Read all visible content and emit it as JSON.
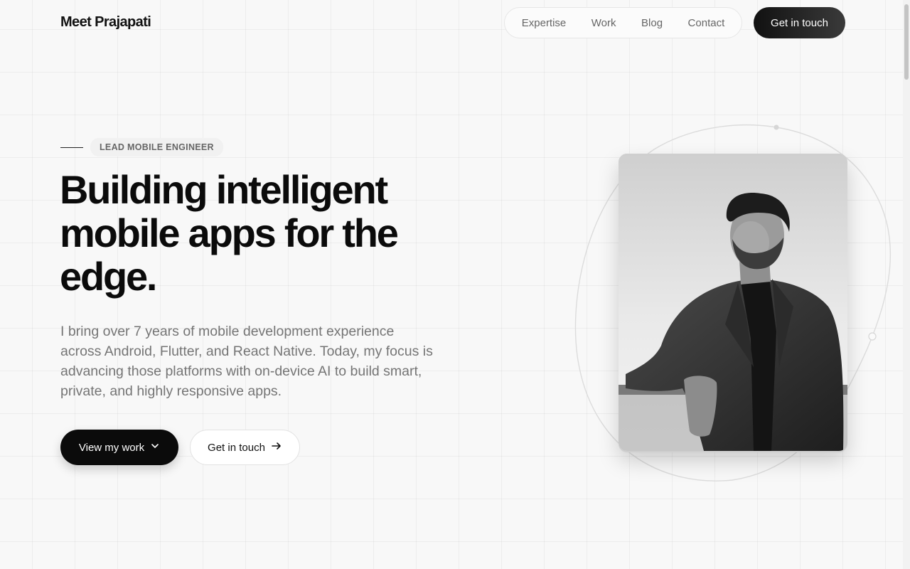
{
  "header": {
    "brand": "Meet Prajapati",
    "nav": [
      "Expertise",
      "Work",
      "Blog",
      "Contact"
    ],
    "cta_label": "Get in touch"
  },
  "hero": {
    "eyebrow": "LEAD MOBILE ENGINEER",
    "headline_lines": [
      "Building intelligent",
      "mobile apps for the",
      "edge."
    ],
    "lead": "I bring over 7 years of mobile development experience across Android, Flutter, and React Native. Today, my focus is advancing those platforms with on-device AI to build smart, private, and highly responsive apps.",
    "primary_button": "View my work",
    "secondary_button": "Get in touch"
  },
  "icons": {
    "primary_button_icon": "chevron-down-icon",
    "secondary_button_icon": "arrow-right-icon"
  }
}
